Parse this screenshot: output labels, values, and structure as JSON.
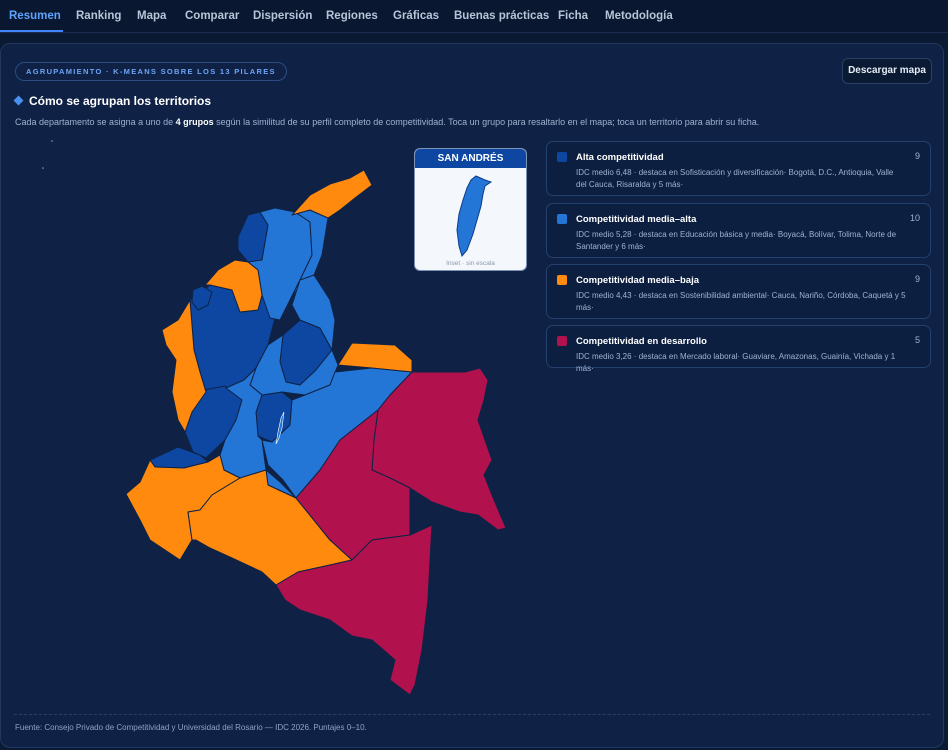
{
  "nav": {
    "tabs": [
      {
        "label": "Resumen",
        "active": true
      },
      {
        "label": "Ranking"
      },
      {
        "label": "Mapa"
      },
      {
        "label": "Comparar"
      },
      {
        "label": "Dispersión"
      },
      {
        "label": "Regiones"
      },
      {
        "label": "Gráficas"
      },
      {
        "label": "Buenas prácticas"
      },
      {
        "label": "Ficha"
      },
      {
        "label": "Metodología"
      }
    ]
  },
  "chip_label": "AGRUPAMIENTO · K-MEANS SOBRE LOS 13 PILARES",
  "download_label": "Descargar mapa",
  "section": {
    "title": "Cómo se agrupan los territorios",
    "desc_before": "Cada departamento se asigna a uno de ",
    "desc_bold": "4 grupos",
    "desc_after": " según la similitud de su perfil completo de competitividad. Toca un grupo para resaltarlo en el mapa; toca un territorio para abrir su ficha."
  },
  "inset": {
    "title": "SAN ANDRÉS",
    "note": "Inset · sin escala"
  },
  "groups": [
    {
      "name": "Alta competitividad",
      "count": "9",
      "color": "#0d47a1",
      "desc": "IDC medio 6,48 · destaca en Sofisticación y diversificación· Bogotá, D.C., Antioquia, Valle del Cauca, Risaralda y 5 más·"
    },
    {
      "name": "Competitividad media–alta",
      "count": "10",
      "color": "#2476d6",
      "desc": "IDC medio 5,28 · destaca en Educación básica y media· Boyacá, Bolívar, Tolima, Norte de Santander y 6 más·"
    },
    {
      "name": "Competitividad media–baja",
      "count": "9",
      "color": "#ff8a0d",
      "desc": "IDC medio 4,43 · destaca en Sostenibilidad ambiental· Cauca, Nariño, Córdoba, Caquetá y 5 más·"
    },
    {
      "name": "Competitividad en desarrollo",
      "count": "5",
      "color": "#b1124d",
      "desc": "IDC medio 3,26 · destaca en Mercado laboral· Guaviare, Amazonas, Guainía, Vichada y 1 más·"
    }
  ],
  "footer": "Fuente: Consejo Privado de Competitividad y Universidad del Rosario — IDC 2026. Puntajes 0–10."
}
